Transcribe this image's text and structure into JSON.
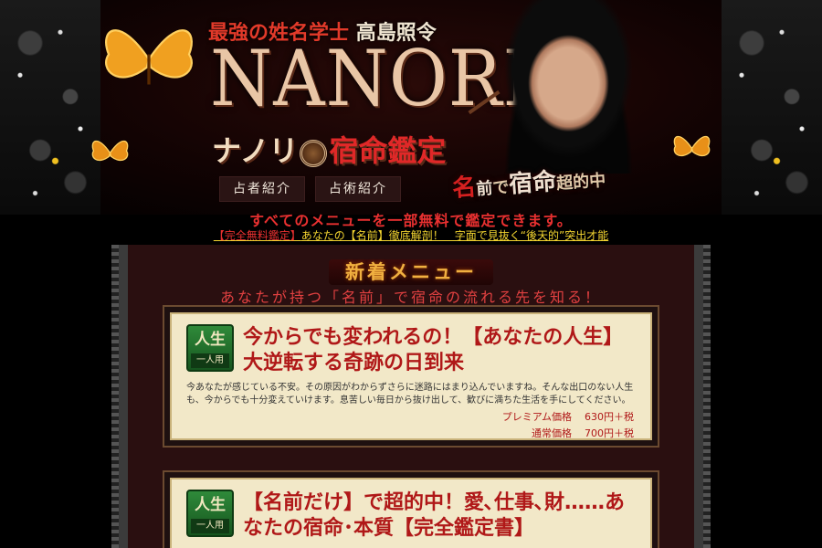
{
  "header": {
    "tagline_prefix": "最強の姓名学士",
    "tagline_name": "高島照令",
    "logo": "NANORI",
    "sub_left": "ナノリ",
    "sub_right": "宿命鑑定",
    "catch_a": "名",
    "catch_b": "前",
    "catch_c": "で",
    "catch_d": "宿命",
    "catch_e": "超的中"
  },
  "nav": [
    {
      "label": "占者紹介"
    },
    {
      "label": "占術紹介"
    }
  ],
  "announcement": {
    "line1": "すべてのメニューを一部無料で鑑定できます。",
    "link_red": "【完全無料鑑定】",
    "link_rest": "あなたの【名前】徹底解剖！　字面で見抜く“後天的”突出才能"
  },
  "news": {
    "title": "新着メニュー",
    "subtitle": "あなたが持つ「名前」で宿命の流れる先を知る！"
  },
  "cards": [
    {
      "badge_main": "人生",
      "badge_sub": "一人用",
      "title": "今からでも変われるの！【あなたの人生】大逆転する奇跡の日到来",
      "desc": "今あなたが感じている不安。その原因がわからずさらに迷路にはまり込んでいますね。そんな出口のない人生も、今からでも十分変えていけます。息苦しい毎日から抜け出して、歓びに満ちた生活を手にしてください。",
      "price_premium_label": "プレミアム価格",
      "price_premium": "630円＋税",
      "price_normal_label": "通常価格",
      "price_normal": "700円＋税"
    },
    {
      "badge_main": "人生",
      "badge_sub": "一人用",
      "title": "【名前だけ】で超的中！愛､仕事､財……あなたの宿命･本質【完全鑑定書】"
    }
  ],
  "colors": {
    "accent_red": "#e83030",
    "link_yellow": "#f2d430",
    "card_bg": "#f2e8c8",
    "badge_green": "#2f8a3a",
    "title_red": "#b01818"
  }
}
